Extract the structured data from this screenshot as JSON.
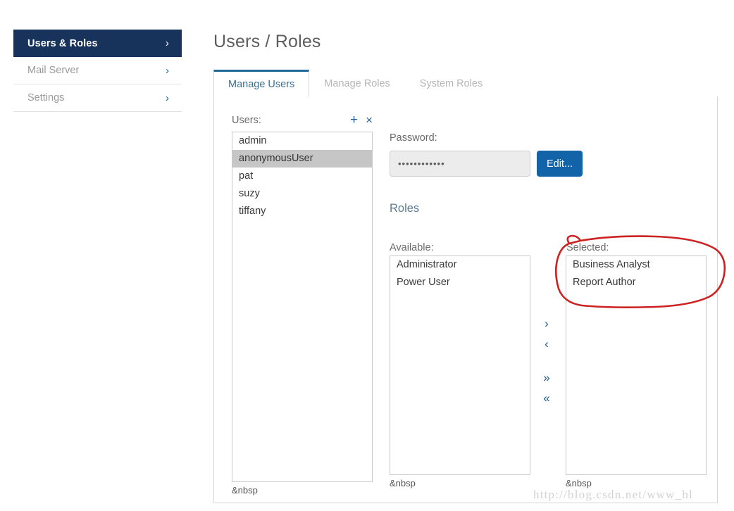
{
  "sidebar": {
    "items": [
      {
        "label": "Users & Roles",
        "chevron": "›",
        "active": true
      },
      {
        "label": "Mail Server",
        "chevron": "›",
        "active": false
      },
      {
        "label": "Settings",
        "chevron": "›",
        "active": false
      }
    ]
  },
  "page": {
    "title": "Users / Roles"
  },
  "tabs": [
    {
      "label": "Manage Users",
      "active": true
    },
    {
      "label": "Manage Roles",
      "active": false
    },
    {
      "label": "System Roles",
      "active": false
    }
  ],
  "users_panel": {
    "label": "Users:",
    "add_icon": "+",
    "remove_icon": "×",
    "items": [
      {
        "name": "admin",
        "selected": false
      },
      {
        "name": "anonymousUser",
        "selected": true
      },
      {
        "name": "pat",
        "selected": false
      },
      {
        "name": "suzy",
        "selected": false
      },
      {
        "name": "tiffany",
        "selected": false
      }
    ],
    "footer": "&nbsp"
  },
  "password": {
    "label": "Password:",
    "value": "••••••••••••",
    "edit_label": "Edit..."
  },
  "roles": {
    "heading": "Roles",
    "available": {
      "label": "Available:",
      "items": [
        "Administrator",
        "Power User"
      ],
      "footer": "&nbsp"
    },
    "selected": {
      "label": "Selected:",
      "items": [
        "Business Analyst",
        "Report Author"
      ],
      "footer": "&nbsp"
    },
    "transfer": {
      "move_right": "›",
      "move_left": "‹",
      "move_all_right": "»",
      "move_all_left": "«"
    }
  },
  "annotation": {
    "shape": "hand-drawn-red-ellipse",
    "color": "#cc2222",
    "target": "Selected roles list"
  },
  "watermark": {
    "text": "http://blog.csdn.net/www_hl"
  },
  "colors": {
    "sidebar_active_bg": "#17325b",
    "tab_active_border": "#1f6a9a",
    "primary_button": "#1263a8",
    "icon_blue": "#2a6496",
    "list_selected_bg": "#c6c6c6",
    "annotation_red": "#cc2222"
  }
}
